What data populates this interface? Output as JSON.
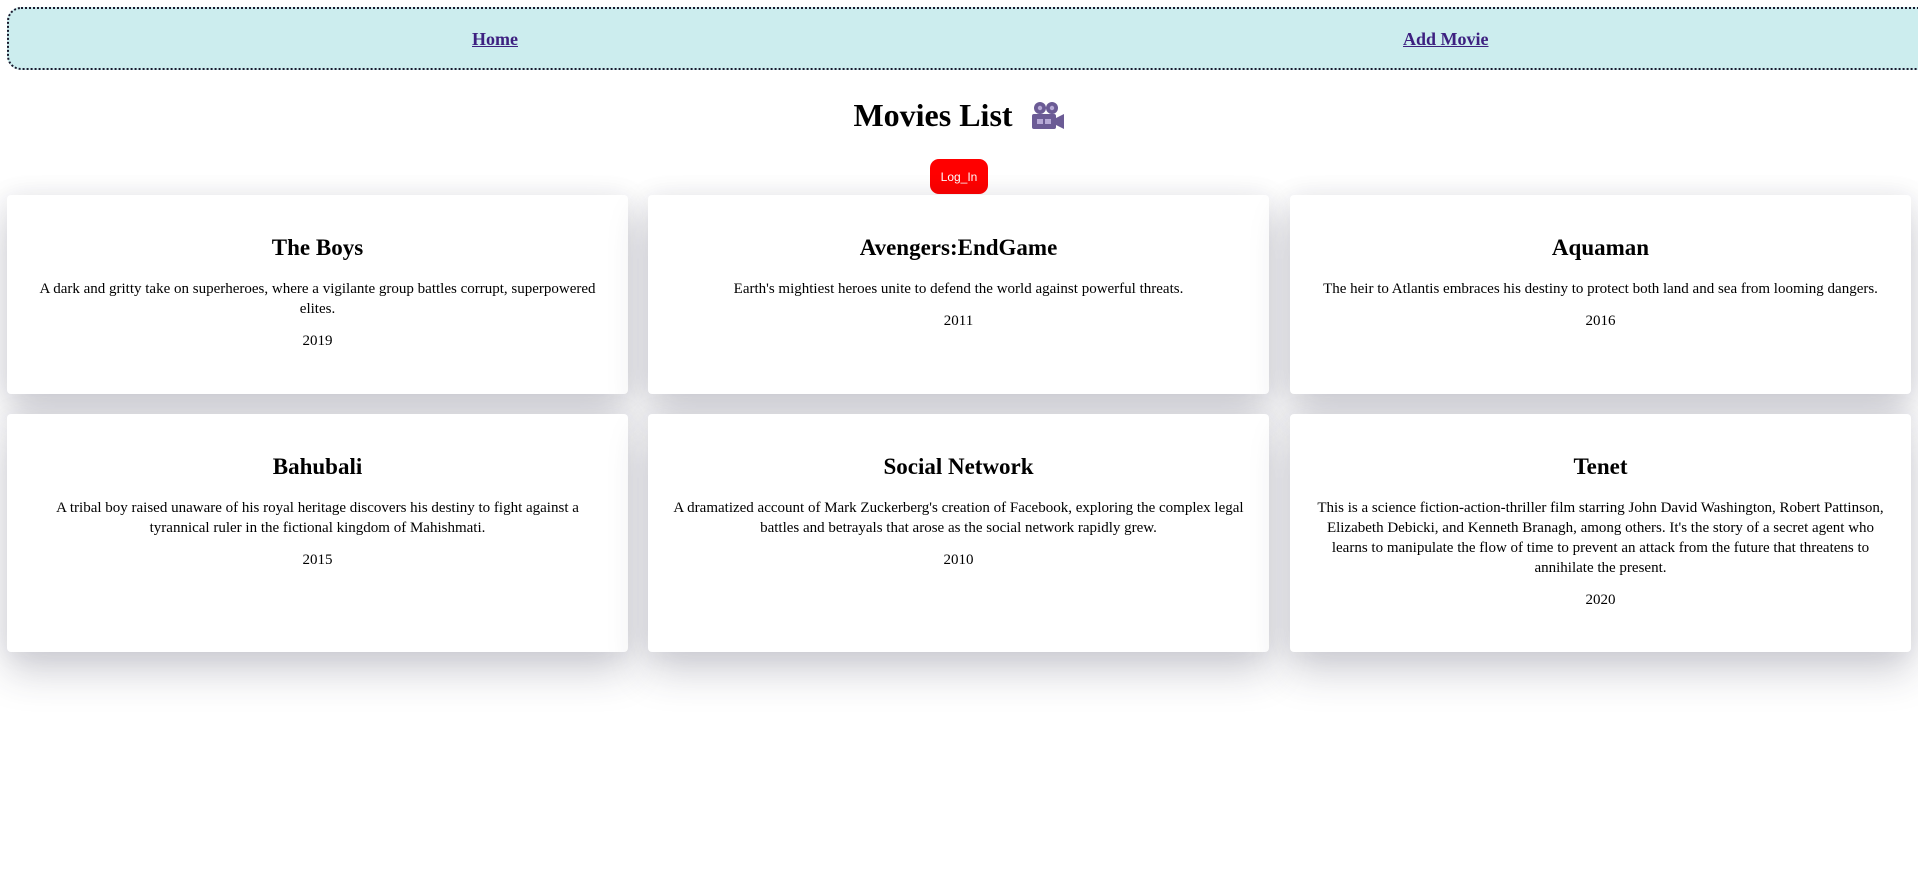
{
  "nav": {
    "home_label": "Home",
    "add_movie_label": "Add Movie",
    "background": "#ccedee",
    "link_color": "#3d2080"
  },
  "page": {
    "title": "Movies List",
    "title_icon": "movie-camera-icon"
  },
  "login": {
    "label": "Log_In",
    "color": "#ff0000"
  },
  "movies": [
    {
      "title": "The Boys",
      "description": "A dark and gritty take on superheroes, where a vigilante group battles corrupt, superpowered elites.",
      "year": "2019"
    },
    {
      "title": "Avengers:EndGame",
      "description": "Earth's mightiest heroes unite to defend the world against powerful threats.",
      "year": "2011"
    },
    {
      "title": "Aquaman",
      "description": "The heir to Atlantis embraces his destiny to protect both land and sea from looming dangers.",
      "year": "2016"
    },
    {
      "title": "Bahubali",
      "description": "A tribal boy raised unaware of his royal heritage discovers his destiny to fight against a tyrannical ruler in the fictional kingdom of Mahishmati.",
      "year": "2015"
    },
    {
      "title": "Social Network",
      "description": "A dramatized account of Mark Zuckerberg's creation of Facebook, exploring the complex legal battles and betrayals that arose as the social network rapidly grew.",
      "year": "2010"
    },
    {
      "title": "Tenet",
      "description": "This is a science fiction-action-thriller film starring John David Washington, Robert Pattinson, Elizabeth Debicki, and Kenneth Branagh, among others. It's the story of a secret agent who learns to manipulate the flow of time to prevent an attack from the future that threatens to annihilate the present.",
      "year": "2020"
    }
  ]
}
